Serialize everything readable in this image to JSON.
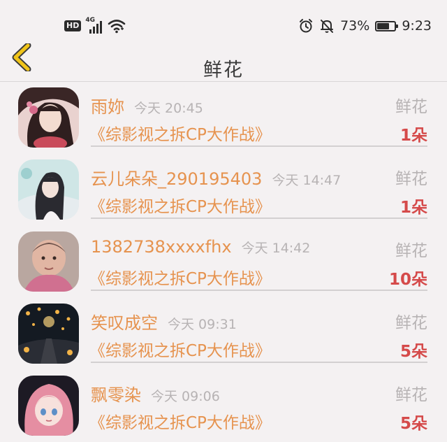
{
  "status_bar": {
    "hd": "HD",
    "network": "4G",
    "battery_percent": "73%",
    "battery_level": 0.73,
    "time": "9:23",
    "icons": [
      "signal-icon",
      "wifi-icon",
      "alarm-icon",
      "mute-bell-icon",
      "battery-icon"
    ]
  },
  "header": {
    "title": "鲜花",
    "back_icon": "chevron-left-icon"
  },
  "colors": {
    "accent": "#e6934f",
    "count": "#d54a4a",
    "back": "#f0c419",
    "muted": "#b7b3b4"
  },
  "items": [
    {
      "name": "雨妳",
      "time": "今天 20:45",
      "gift": "鲜花",
      "work": "《综影视之拆CP大作战》",
      "count": "1朵"
    },
    {
      "name": "云儿朵朵_290195403",
      "time": "今天 14:47",
      "gift": "鲜花",
      "work": "《综影视之拆CP大作战》",
      "count": "1朵"
    },
    {
      "name": "1382738xxxxfhx",
      "time": "今天 14:42",
      "gift": "鲜花",
      "work": "《综影视之拆CP大作战》",
      "count": "10朵"
    },
    {
      "name": "笑叹成空",
      "time": "今天 09:31",
      "gift": "鲜花",
      "work": "《综影视之拆CP大作战》",
      "count": "5朵"
    },
    {
      "name": "飘零染",
      "time": "今天 09:06",
      "gift": "鲜花",
      "work": "《综影视之拆CP大作战》",
      "count": "5朵"
    }
  ]
}
